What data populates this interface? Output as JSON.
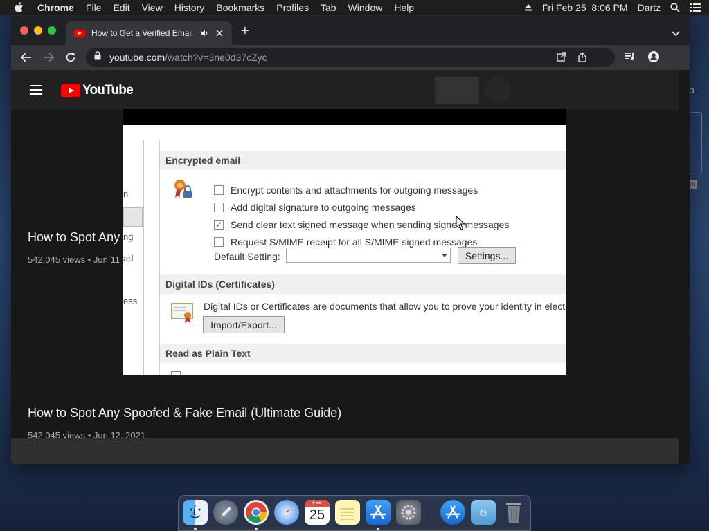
{
  "menubar": {
    "app_name": "Chrome",
    "items": [
      "File",
      "Edit",
      "View",
      "History",
      "Bookmarks",
      "Profiles",
      "Tab",
      "Window",
      "Help"
    ],
    "datetime": "Fri Feb 25  8:06 PM",
    "user": "Dartz"
  },
  "browser": {
    "tab_title": "How to Get a Verified Email",
    "url_host": "youtube.com",
    "url_path": "/watch?v=3ne0d37cZyc"
  },
  "youtube": {
    "logo_text": "YouTube",
    "cards": [
      {
        "title": "How to Spot Any",
        "meta": "542,045 views • Jun 11"
      },
      {
        "title": "How to Spot Any Spoofed & Fake Email (Ultimate Guide)",
        "meta": "542,045 views • Jun 12, 2021"
      }
    ]
  },
  "video": {
    "left_fragments": [
      "n",
      "ng",
      "ad",
      "ess"
    ],
    "encrypted_header": "Encrypted email",
    "options": [
      {
        "label": "Encrypt contents and attachments for outgoing messages",
        "checked": false
      },
      {
        "label": "Add digital signature to outgoing messages",
        "checked": false
      },
      {
        "label": "Send clear text signed message when sending signed messages",
        "checked": true
      },
      {
        "label": "Request S/MIME receipt for all S/MIME signed messages",
        "checked": false
      }
    ],
    "default_setting_label": "Default Setting:",
    "settings_button": "Settings...",
    "digital_ids_header": "Digital IDs (Certificates)",
    "digital_ids_text": "Digital IDs or Certificates are documents that allow you to prove your identity in electro",
    "import_export_button": "Import/Export...",
    "plain_text_header": "Read as Plain Text"
  },
  "desktop": {
    "partial_char": "o",
    "partial_tag": "m"
  },
  "dock": {
    "calendar_month": "FEB",
    "calendar_day": "25"
  }
}
